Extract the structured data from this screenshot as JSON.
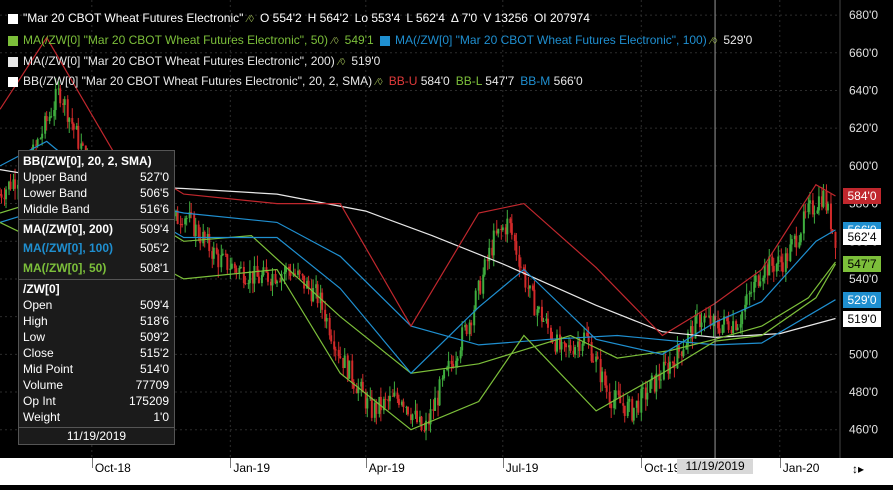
{
  "header": {
    "symbol": "\"Mar 20 CBOT Wheat Futures Electronic\"",
    "open": "O 554'2",
    "high": "H 564'2",
    "low": "Lo 553'4",
    "last": "L 562'4",
    "change": "Δ 7'0",
    "volume": "V 13256",
    "open_interest": "OI 207974"
  },
  "studies": [
    {
      "label": "MA(/ZW[0] \"Mar 20 CBOT Wheat Futures Electronic\", 50)",
      "value": "549'1",
      "color": "#7cbf3a"
    },
    {
      "label": "MA(/ZW[0] \"Mar 20 CBOT Wheat Futures Electronic\", 100)",
      "value": "529'0",
      "color": "#1f8fd0"
    },
    {
      "label": "MA(/ZW[0] \"Mar 20 CBOT Wheat Futures Electronic\", 200)",
      "value": "519'0",
      "color": "#e8e8e8"
    },
    {
      "label": "BB(/ZW[0] \"Mar 20 CBOT Wheat Futures Electronic\", 20, 2, SMA)",
      "bbu": "BB-U",
      "bbu_value": "584'0",
      "bbl": "BB-L",
      "bbl_value": "547'7",
      "bbm": "BB-M",
      "bbm_value": "566'0",
      "color": "#ffffff"
    }
  ],
  "tooltip": {
    "bb_title": "BB(/ZW[0], 20, 2, SMA)",
    "upper_band": {
      "label": "Upper Band",
      "value": "527'0"
    },
    "lower_band": {
      "label": "Lower Band",
      "value": "506'5"
    },
    "middle_band": {
      "label": "Middle Band",
      "value": "516'6"
    },
    "ma200": {
      "label": "MA(/ZW[0], 200)",
      "value": "509'4"
    },
    "ma100": {
      "label": "MA(/ZW[0], 100)",
      "value": "505'2"
    },
    "ma50": {
      "label": "MA(/ZW[0], 50)",
      "value": "508'1"
    },
    "symbol": "/ZW[0]",
    "open": {
      "label": "Open",
      "value": "509'4"
    },
    "high": {
      "label": "High",
      "value": "518'6"
    },
    "low": {
      "label": "Low",
      "value": "509'2"
    },
    "close": {
      "label": "Close",
      "value": "515'2"
    },
    "mid": {
      "label": "Mid Point",
      "value": "514'0"
    },
    "volume": {
      "label": "Volume",
      "value": "77709"
    },
    "op_int": {
      "label": "Op Int",
      "value": "175209"
    },
    "weight": {
      "label": "Weight",
      "value": "1'0"
    },
    "date": "11/19/2019"
  },
  "crosshair_date": "11/19/2019",
  "price_tags": [
    {
      "text": "584'0",
      "bg": "#c0272d",
      "fg": "#ffffff",
      "price": 584
    },
    {
      "text": "566'0",
      "bg": "#1f8fd0",
      "fg": "#ffffff",
      "price": 566
    },
    {
      "text": "562'4",
      "bg": "#ffffff",
      "fg": "#000000",
      "price": 562.5
    },
    {
      "text": "547'7",
      "bg": "#7cbf3a",
      "fg": "#000000",
      "price": 547.875
    },
    {
      "text": "529'0",
      "bg": "#1f8fd0",
      "fg": "#ffffff",
      "price": 529
    },
    {
      "text": "519'0",
      "bg": "#ffffff",
      "fg": "#000000",
      "price": 519
    }
  ],
  "chart_data": {
    "type": "line",
    "ylim": [
      445,
      688
    ],
    "y_ticks": [
      "680'0",
      "660'0",
      "640'0",
      "620'0",
      "600'0",
      "580'0",
      "560'0",
      "540'0",
      "520'0",
      "500'0",
      "480'0",
      "460'0"
    ],
    "y_tick_values": [
      680,
      660,
      640,
      620,
      600,
      580,
      560,
      540,
      520,
      500,
      480,
      460
    ],
    "x_ticks": [
      "Oct-18",
      "Jan-19",
      "Apr-19",
      "Jul-19",
      "Oct-19",
      "Jan-20"
    ],
    "x_tick_dates": [
      "2018-10-01",
      "2019-01-01",
      "2019-04-01",
      "2019-07-01",
      "2019-10-01",
      "2020-01-01"
    ],
    "x_range": [
      "2018-08-01",
      "2020-02-10"
    ],
    "series": [
      {
        "name": "MA(/ZW[0], 200)",
        "color": "#e8e8e8",
        "x": [
          "2018-08-01",
          "2018-10-01",
          "2018-12-01",
          "2019-02-01",
          "2019-04-01",
          "2019-05-15",
          "2019-07-01",
          "2019-09-01",
          "2019-10-15",
          "2019-11-19",
          "2020-01-01",
          "2020-02-07"
        ],
        "y": [
          598,
          590,
          588,
          585,
          576,
          563,
          548,
          526,
          512,
          509,
          511,
          519
        ]
      },
      {
        "name": "MA(/ZW[0], 100)",
        "color": "#1f8fd0",
        "x": [
          "2018-08-01",
          "2018-10-01",
          "2018-12-01",
          "2019-02-01",
          "2019-03-15",
          "2019-05-01",
          "2019-06-15",
          "2019-08-01",
          "2019-09-15",
          "2019-11-19",
          "2019-12-20",
          "2020-02-07"
        ],
        "y": [
          570,
          585,
          575,
          570,
          552,
          515,
          505,
          508,
          510,
          505,
          506,
          529
        ]
      },
      {
        "name": "MA(/ZW[0], 50)",
        "color": "#7cbf3a",
        "x": [
          "2018-08-01",
          "2018-10-01",
          "2018-12-01",
          "2019-01-15",
          "2019-03-15",
          "2019-05-01",
          "2019-06-15",
          "2019-08-15",
          "2019-09-15",
          "2019-10-20",
          "2019-11-19",
          "2019-12-20",
          "2020-01-20",
          "2020-02-07"
        ],
        "y": [
          575,
          590,
          560,
          563,
          520,
          490,
          495,
          510,
          498,
          502,
          508,
          515,
          530,
          549
        ]
      },
      {
        "name": "BB-U",
        "color": "#c0272d",
        "x": [
          "2018-08-01",
          "2018-09-01",
          "2018-10-15",
          "2018-12-01",
          "2019-02-01",
          "2019-03-15",
          "2019-05-01",
          "2019-06-15",
          "2019-07-15",
          "2019-09-01",
          "2019-10-15",
          "2019-11-19",
          "2019-12-20",
          "2020-01-25",
          "2020-02-07"
        ],
        "y": [
          630,
          668,
          608,
          585,
          580,
          580,
          515,
          575,
          580,
          546,
          510,
          527,
          545,
          590,
          584
        ]
      },
      {
        "name": "BB-L",
        "color": "#7cbf3a",
        "x": [
          "2018-08-01",
          "2018-09-01",
          "2018-10-15",
          "2018-12-01",
          "2019-02-01",
          "2019-03-15",
          "2019-05-01",
          "2019-06-15",
          "2019-07-15",
          "2019-09-01",
          "2019-10-15",
          "2019-11-19",
          "2019-12-20",
          "2020-01-25",
          "2020-02-07"
        ],
        "y": [
          570,
          558,
          560,
          540,
          545,
          490,
          460,
          475,
          510,
          470,
          490,
          507,
          510,
          530,
          548
        ]
      },
      {
        "name": "BB-M",
        "color": "#1f8fd0",
        "x": [
          "2018-08-01",
          "2018-09-01",
          "2018-10-15",
          "2018-12-01",
          "2019-02-01",
          "2019-03-15",
          "2019-05-01",
          "2019-06-15",
          "2019-07-15",
          "2019-09-01",
          "2019-10-15",
          "2019-11-19",
          "2019-12-20",
          "2020-01-25",
          "2020-02-07"
        ],
        "y": [
          600,
          613,
          584,
          562,
          562,
          535,
          490,
          525,
          545,
          508,
          500,
          517,
          528,
          560,
          566
        ]
      }
    ],
    "price_path": {
      "x": [
        "2018-08-01",
        "2018-08-20",
        "2018-09-10",
        "2018-10-01",
        "2018-10-20",
        "2018-11-10",
        "2018-12-01",
        "2018-12-25",
        "2019-01-20",
        "2019-02-10",
        "2019-03-01",
        "2019-03-15",
        "2019-04-05",
        "2019-04-25",
        "2019-05-10",
        "2019-05-20",
        "2019-06-10",
        "2019-06-25",
        "2019-07-05",
        "2019-07-20",
        "2019-08-10",
        "2019-08-25",
        "2019-09-10",
        "2019-09-25",
        "2019-10-10",
        "2019-10-25",
        "2019-11-10",
        "2019-11-19",
        "2019-12-05",
        "2019-12-20",
        "2020-01-05",
        "2020-01-20",
        "2020-01-30",
        "2020-02-07"
      ],
      "y": [
        585,
        600,
        640,
        595,
        575,
        560,
        575,
        550,
        540,
        545,
        530,
        500,
        470,
        478,
        458,
        480,
        520,
        560,
        570,
        530,
        500,
        510,
        478,
        470,
        485,
        500,
        520,
        515,
        518,
        545,
        550,
        575,
        585,
        562
      ]
    }
  }
}
